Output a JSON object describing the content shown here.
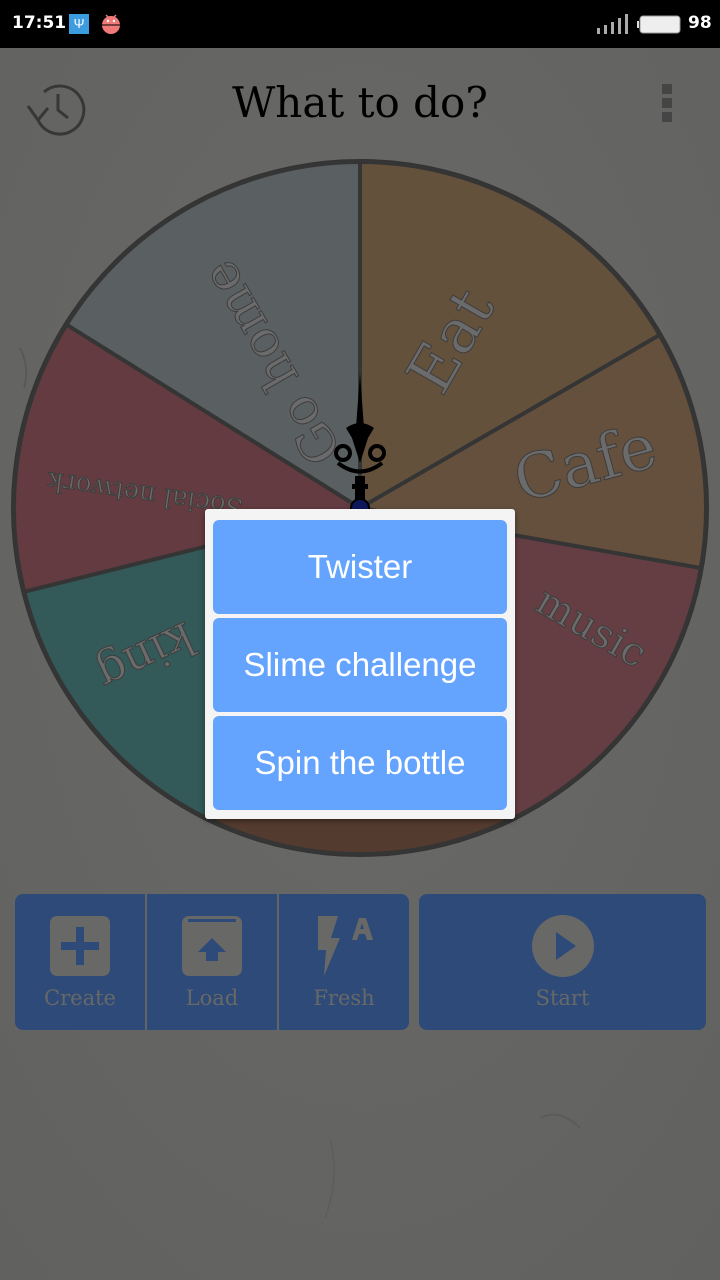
{
  "status_bar": {
    "time": "17:51",
    "battery_level": "98",
    "notification_icons": [
      "usb-icon",
      "android-debug-icon"
    ]
  },
  "header": {
    "title": "What to do?",
    "history_icon": "history-icon",
    "menu_icon": "more-vert-icon"
  },
  "wheel": {
    "segments": [
      {
        "label": "Eat",
        "color": "#c9a278"
      },
      {
        "label": "Cafe",
        "color": "#c9a07a"
      },
      {
        "label": "music",
        "color": "#c97c87"
      },
      {
        "label": "",
        "color": "#a97660"
      },
      {
        "label": "king",
        "color": "#66b2b0"
      },
      {
        "label": "Social network",
        "color": "#c67780"
      },
      {
        "label": "Go home",
        "color": "#b4bfc3"
      }
    ],
    "pointer_icon": "ornate-pointer-icon"
  },
  "toolbar": {
    "buttons": [
      {
        "label": "Create",
        "icon": "plus-box-icon"
      },
      {
        "label": "Load",
        "icon": "upload-box-icon"
      },
      {
        "label": "Fresh",
        "icon": "flash-auto-icon"
      }
    ],
    "start": {
      "label": "Start",
      "icon": "play-circle-icon"
    }
  },
  "dialog": {
    "options": [
      "Twister",
      "Slime challenge",
      "Spin the bottle"
    ]
  },
  "colors": {
    "button_blue": "#5a94f2",
    "dialog_option_blue": "#64a4fe",
    "dialog_bg": "#f4f4f4"
  }
}
